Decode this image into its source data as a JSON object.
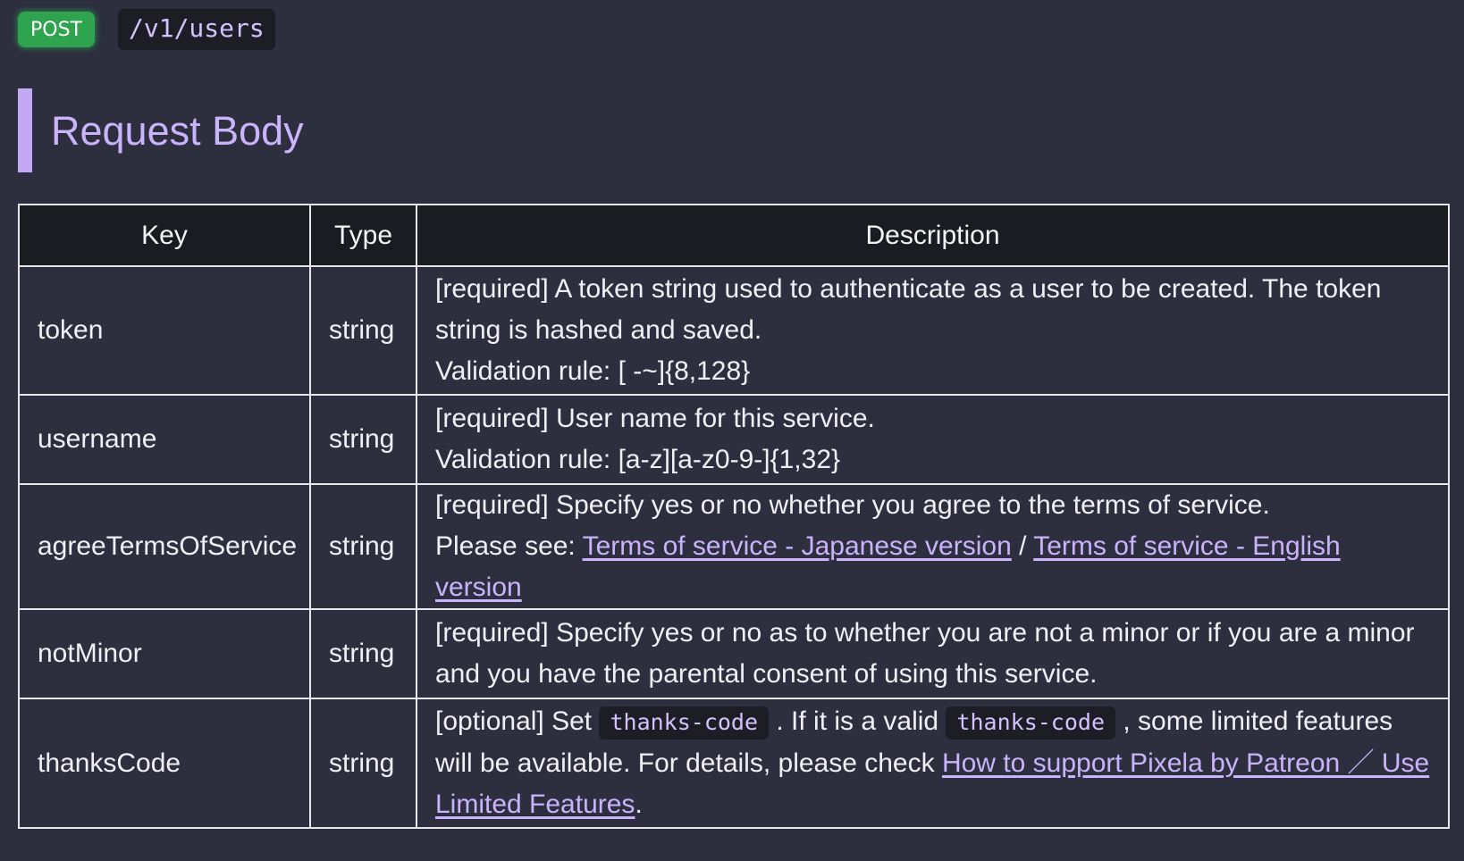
{
  "endpoint": {
    "method": "POST",
    "path": "/v1/users"
  },
  "section": {
    "title": "Request Body"
  },
  "table": {
    "headers": {
      "key": "Key",
      "type": "Type",
      "description": "Description"
    },
    "rows": [
      {
        "key": "token",
        "type": "string",
        "desc_line1": "[required] A token string used to authenticate as a user to be created. The token",
        "desc_line2": "string is hashed and saved.",
        "desc_line3": "Validation rule: [ -~]{8,128}"
      },
      {
        "key": "username",
        "type": "string",
        "desc_line1": "[required] User name for this service.",
        "desc_line2": "Validation rule: [a-z][a-z0-9-]{1,32}"
      },
      {
        "key": "agreeTermsOfService",
        "type": "string",
        "desc_line1": "[required] Specify yes or no whether you agree to the terms of service.",
        "please_see": "Please see: ",
        "link_japanese": "Terms of service - Japanese version",
        "separator": " / ",
        "link_english": "Terms of service - English version"
      },
      {
        "key": "notMinor",
        "type": "string",
        "desc_line1": "[required] Specify yes or no as to whether you are not a minor or if you are a minor",
        "desc_line2": "and you have the parental consent of using this service."
      },
      {
        "key": "thanksCode",
        "type": "string",
        "text_optional_set": "[optional] Set ",
        "code1": "thanks-code",
        "text_if_valid": " . If it is a valid ",
        "code2": "thanks-code",
        "text_some_limited": " , some limited features",
        "text_line2": "will be available. For details, please check ",
        "link_patreon": "How to support Pixela by Patreon ／ Use Limited Features",
        "text_period": "."
      }
    ]
  }
}
